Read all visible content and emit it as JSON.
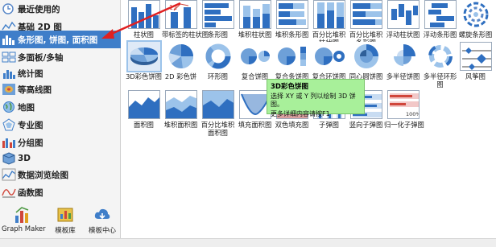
{
  "sidebar": {
    "categories": [
      {
        "label": "最近使用的"
      },
      {
        "label": "基础 2D 图"
      },
      {
        "label": "条形图, 饼图, 面积图"
      },
      {
        "label": "多面板/多轴"
      },
      {
        "label": "统计图"
      },
      {
        "label": "等高线图"
      },
      {
        "label": "地图"
      },
      {
        "label": "专业图"
      },
      {
        "label": "分组图"
      },
      {
        "label": "3D"
      },
      {
        "label": "数据浏览绘图"
      },
      {
        "label": "函数图"
      }
    ],
    "tools": [
      {
        "label": "Graph Maker"
      },
      {
        "label": "模板库"
      },
      {
        "label": "模板中心"
      }
    ]
  },
  "row1": [
    {
      "label": "柱状图"
    },
    {
      "label": "带标签的柱状图"
    },
    {
      "label": "条形图"
    },
    {
      "label": "堆积柱状图"
    },
    {
      "label": "堆积条形图"
    },
    {
      "label": "百分比堆积柱状图"
    },
    {
      "label": "百分比堆积条形图"
    },
    {
      "label": "浮动柱状图"
    },
    {
      "label": "浮动条形图"
    },
    {
      "label": "螺旋条形图"
    }
  ],
  "row2": [
    {
      "label": "3D彩色饼图"
    },
    {
      "label": "2D 彩色饼"
    },
    {
      "label": "环形图"
    },
    {
      "label": "复合饼图"
    },
    {
      "label": "复合条饼图"
    },
    {
      "label": "复合环饼图"
    },
    {
      "label": "同心圆饼图"
    },
    {
      "label": "多半径饼图"
    },
    {
      "label": "多半径环形图"
    },
    {
      "label": "风筝图"
    }
  ],
  "row3": [
    {
      "label": "面积图"
    },
    {
      "label": "堆积面积图"
    },
    {
      "label": "百分比堆积面积图"
    },
    {
      "label": "填充面积图"
    },
    {
      "label": "双色填充图"
    },
    {
      "label": "子弹图"
    },
    {
      "label": "竖向子弹图"
    },
    {
      "label": "归一化子弹图"
    }
  ],
  "row1_label_extra": {
    "b1": "12"
  },
  "normalized_percent": "100%",
  "tooltip": {
    "title": "3D彩色饼图",
    "line1": "选择 XY 或 Y 列以绘制 3D 饼图。",
    "line2": "更多详细内容请按F1"
  },
  "colors": {
    "accent": "#3f7ec9",
    "bar": "#2f6fc0",
    "tooltip": "#a8f09a"
  }
}
